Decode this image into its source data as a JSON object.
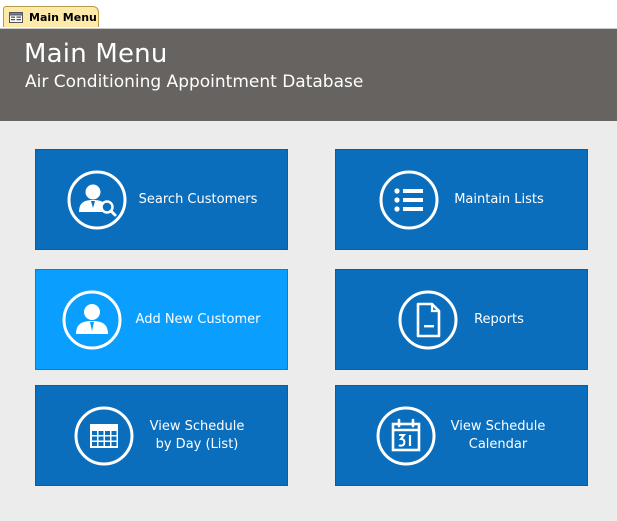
{
  "tab": {
    "label": "Main Menu",
    "icon": "form-icon"
  },
  "header": {
    "title": "Main Menu",
    "subtitle": "Air Conditioning Appointment Database"
  },
  "tiles": [
    {
      "label": "Search Customers",
      "icon": "search-customer-icon"
    },
    {
      "label": "Maintain Lists",
      "icon": "list-icon"
    },
    {
      "label": "Add New Customer",
      "icon": "user-icon",
      "active": true
    },
    {
      "label": "Reports",
      "icon": "document-icon"
    },
    {
      "label": "View Schedule\nby Day (List)",
      "icon": "grid-calendar-icon"
    },
    {
      "label": "View Schedule\nCalendar",
      "icon": "calendar-icon"
    }
  ],
  "colors": {
    "header_bg": "#676360",
    "tile_bg": "#0a6ebd",
    "tile_active_bg": "#0a9eff",
    "page_bg": "#ececec"
  }
}
